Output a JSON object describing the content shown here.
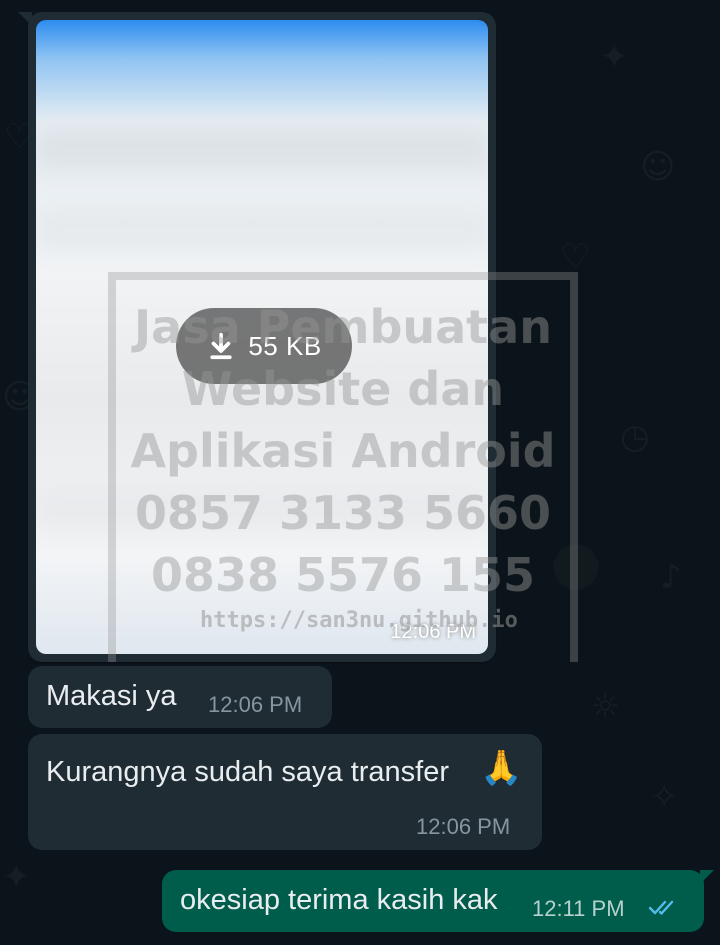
{
  "chat": {
    "image_message": {
      "download_size": "55 KB",
      "time": "12:06 PM",
      "watermark_lines": [
        "Jasa Pembuatan",
        "Website dan",
        "Aplikasi Android",
        "0857 3133 5660",
        "0838 5576 155"
      ],
      "watermark_url": "https://san3nu.github.io"
    },
    "messages": [
      {
        "direction": "incoming",
        "text": "Makasi ya",
        "time": "12:06 PM"
      },
      {
        "direction": "incoming",
        "text": "Kurangnya sudah saya transfer",
        "emoji": "🙏",
        "time": "12:06 PM"
      },
      {
        "direction": "outgoing",
        "text": "okesiap terima kasih kak",
        "time": "12:11 PM",
        "status": "read-double-check-icon"
      }
    ]
  },
  "colors": {
    "background": "#0b141a",
    "incoming_bubble": "#1f2c34",
    "outgoing_bubble": "#005c4b",
    "read_ticks": "#53bdeb",
    "timestamp": "#8696a0"
  }
}
